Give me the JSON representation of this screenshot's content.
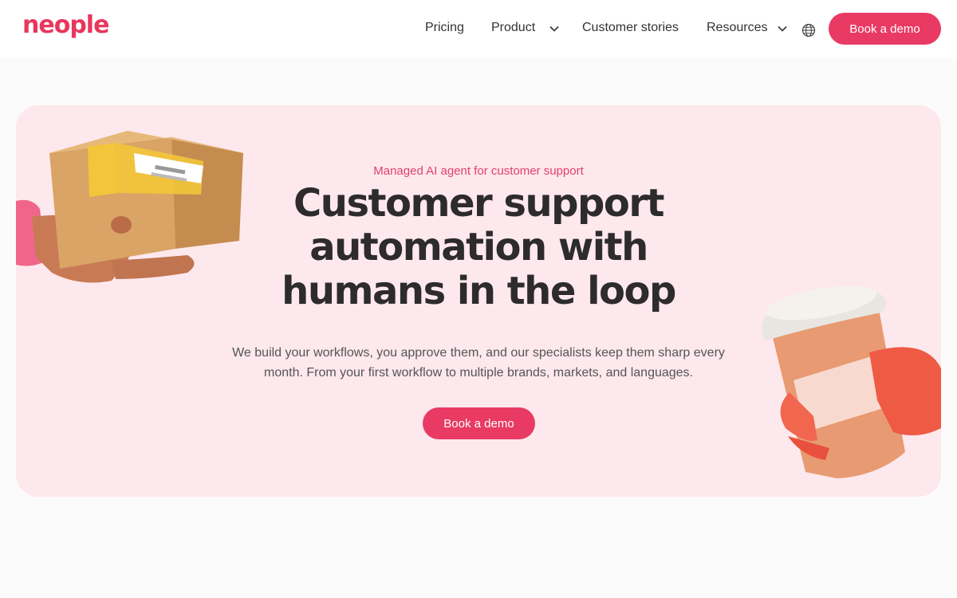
{
  "nav": {
    "logo": "neople",
    "links": [
      {
        "label": "Pricing",
        "has_dropdown": false
      },
      {
        "label": "Product",
        "has_dropdown": true
      },
      {
        "label": "Customer stories",
        "has_dropdown": false
      },
      {
        "label": "Resources",
        "has_dropdown": true
      }
    ],
    "language_icon": "globe-icon",
    "cta": "Book a demo"
  },
  "hero": {
    "eyebrow": "Managed AI agent for customer support",
    "headline": "Customer support automation with humans in the loop",
    "subtext": "We build your workflows, you approve them, and our specialists keep them sharp every month. From your first workflow to multiple brands, markets, and languages.",
    "cta": "Book a demo",
    "illustrations": [
      "hand-holding-package",
      "hand-holding-coffee-cup"
    ]
  },
  "colors": {
    "brand": "#e93a64",
    "hero_bg": "#fde8ed",
    "page_bg": "#fcfbfb"
  }
}
